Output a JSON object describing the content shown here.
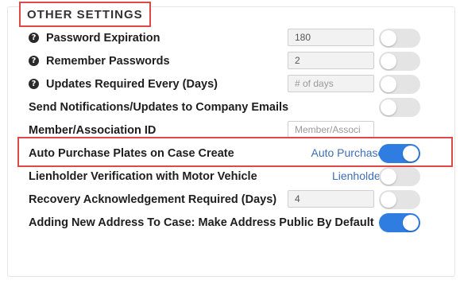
{
  "section": {
    "title": "OTHER SETTINGS"
  },
  "settings": [
    {
      "label": "Password Expiration",
      "help": true,
      "input_value": "180",
      "input_placeholder": "",
      "link": "",
      "toggle": "off"
    },
    {
      "label": "Remember Passwords",
      "help": true,
      "input_value": "2",
      "input_placeholder": "",
      "link": "",
      "toggle": "off"
    },
    {
      "label": "Updates Required Every (Days)",
      "help": true,
      "input_value": "",
      "input_placeholder": "# of days",
      "link": "",
      "toggle": "off"
    },
    {
      "label": "Send Notifications/Updates to Company Emails",
      "help": false,
      "toggle": "off"
    },
    {
      "label": "Member/Association ID",
      "help": false,
      "input_value": "",
      "input_placeholder": "Member/Associ",
      "link": ""
    },
    {
      "label": "Auto Purchase Plates on Case Create",
      "help": false,
      "link": "Auto Purchase List",
      "toggle": "on",
      "highlighted": true
    },
    {
      "label": "Lienholder Verification with Motor Vehicle",
      "help": false,
      "link": "Lienholder List",
      "toggle": "off"
    },
    {
      "label": "Recovery Acknowledgement Required (Days)",
      "help": false,
      "input_value": "4",
      "input_placeholder": "",
      "toggle": "off"
    },
    {
      "label": "Adding New Address To Case: Make Address Public By Default",
      "help": false,
      "toggle": "on"
    }
  ],
  "help_icon_glyph": "?",
  "colors": {
    "accent": "#2f7de1",
    "highlight": "#e04848",
    "link": "#3d6eb8"
  }
}
